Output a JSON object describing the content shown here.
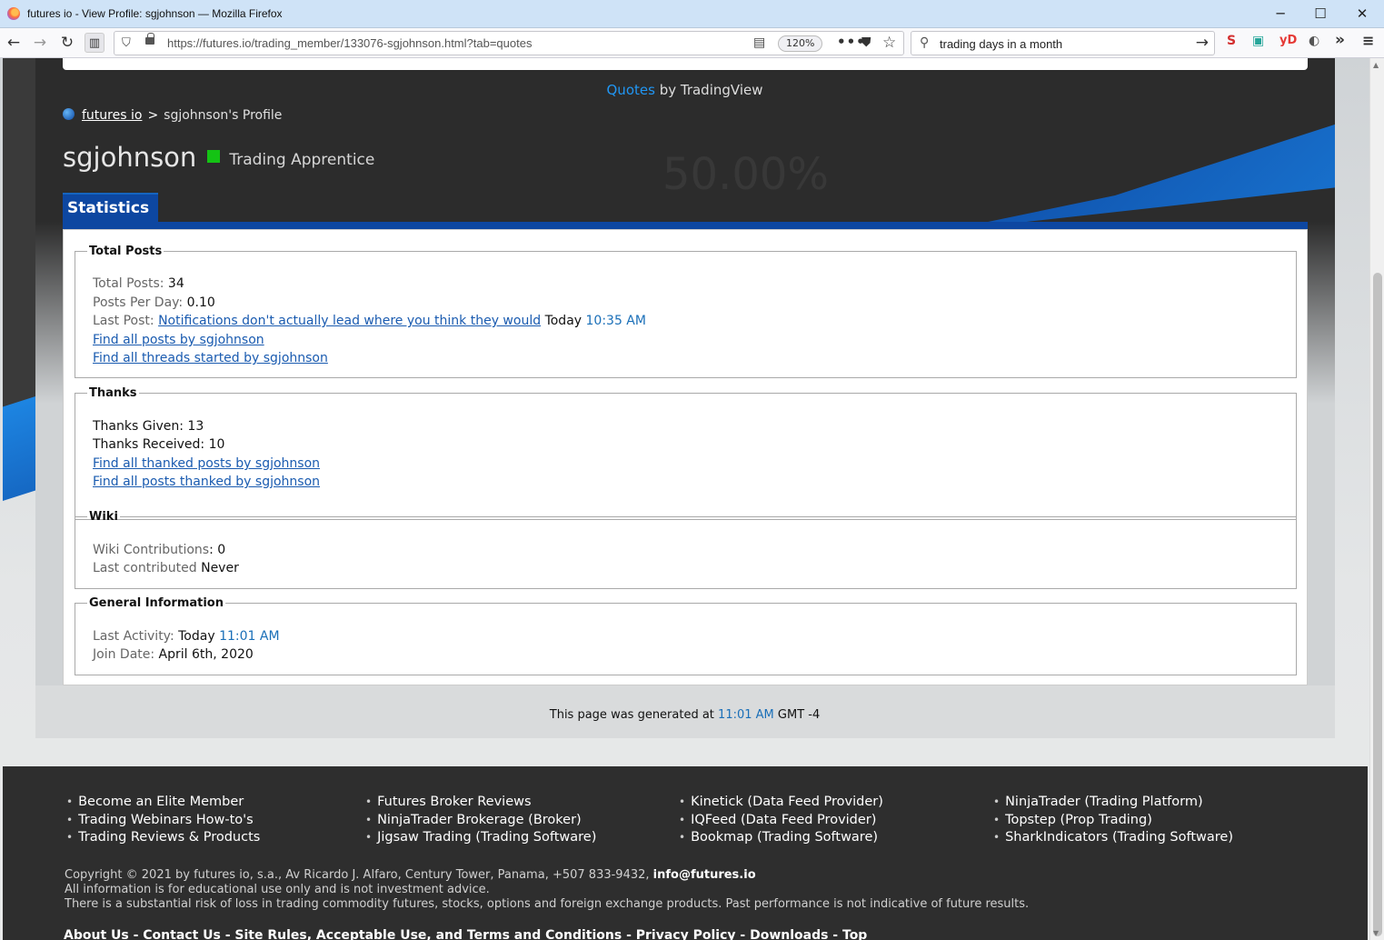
{
  "window": {
    "title": "futures io - View Profile: sgjohnson — Mozilla Firefox",
    "minimize": "─",
    "maximize": "☐",
    "close": "✕"
  },
  "nav": {
    "url": "https://futures.io/trading_member/133076-sgjohnson.html?tab=quotes",
    "zoom": "120%",
    "search_query": "trading days in a month"
  },
  "page": {
    "quotes_link": "Quotes",
    "quotes_suffix": " by TradingView",
    "breadcrumb_home": "futures io",
    "breadcrumb_sep": ">",
    "breadcrumb_current": "sgjohnson's Profile",
    "username": "sgjohnson",
    "rank": "Trading Apprentice",
    "tab_label": "Statistics"
  },
  "total_posts": {
    "legend": "Total Posts",
    "total_label": "Total Posts:",
    "total_value": "34",
    "ppd_label": "Posts Per Day:",
    "ppd_value": "0.10",
    "last_label": "Last Post:",
    "last_link": "Notifications don't actually lead where you think they would",
    "last_day": "Today",
    "last_time": "10:35 AM",
    "find_posts": "Find all posts by sgjohnson",
    "find_threads": "Find all threads started by sgjohnson"
  },
  "thanks": {
    "legend": "Thanks",
    "given": "Thanks Given: 13",
    "received": "Thanks Received: 10",
    "find_thanked": "Find all thanked posts by sgjohnson",
    "find_posts_thanked": "Find all posts thanked by sgjohnson"
  },
  "wiki": {
    "legend": "Wiki",
    "contrib_label": "Wiki Contributions",
    "contrib_value": ": 0",
    "last_label": "Last contributed",
    "last_value": "Never"
  },
  "general": {
    "legend": "General Information",
    "activity_label": "Last Activity:",
    "activity_day": "Today",
    "activity_time": "11:01 AM",
    "join_label": "Join Date:",
    "join_value": "April 6th, 2020"
  },
  "generated": {
    "prefix": "This page was generated at ",
    "time": "11:01 AM",
    "suffix": " GMT -4"
  },
  "footer": {
    "col1": [
      "Become an Elite Member",
      "Trading Webinars How-to's",
      "Trading Reviews & Products"
    ],
    "col2": [
      "Futures Broker Reviews",
      "NinjaTrader Brokerage (Broker)",
      "Jigsaw Trading (Trading Software)"
    ],
    "col3": [
      "Kinetick (Data Feed Provider)",
      "IQFeed (Data Feed Provider)",
      "Bookmap (Trading Software)"
    ],
    "col4": [
      "NinjaTrader (Trading Platform)",
      "Topstep (Prop Trading)",
      "SharkIndicators (Trading Software)"
    ],
    "copyright": "Copyright © 2021 by futures io, s.a., Av Ricardo J. Alfaro, Century Tower, Panama, +507 833-9432, ",
    "email": "info@futures.io",
    "disclaimer1": "All information is for educational use only and is not investment advice.",
    "disclaimer2": "There is a substantial risk of loss in trading commodity futures, stocks, options and foreign exchange products. Past performance is not indicative of future results.",
    "links": [
      "About Us",
      "Contact Us",
      "Site Rules, Acceptable Use, and Terms and Conditions",
      "Privacy Policy",
      "Downloads",
      "Top"
    ]
  }
}
